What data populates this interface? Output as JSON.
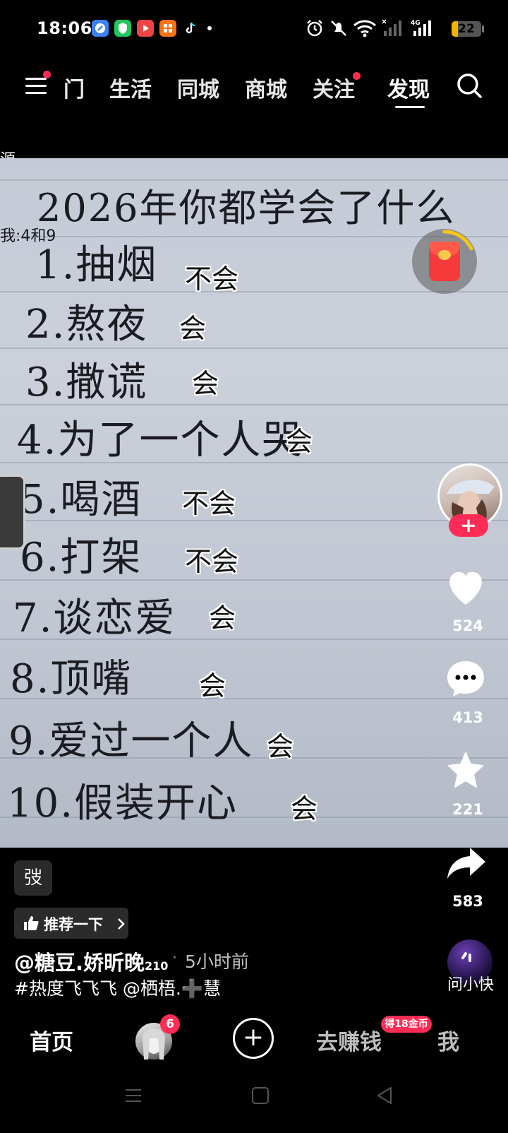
{
  "status_bar": {
    "time": "18:06",
    "battery": "22",
    "battery_level": 0.22,
    "network": "4G",
    "app_icons": [
      "browser-icon",
      "shield-app-icon",
      "video-app-icon",
      "store-app-icon",
      "tiktok-icon"
    ]
  },
  "top_nav": {
    "partial_tab": "门",
    "tabs": [
      "生活",
      "同城",
      "商城",
      "关注",
      "发现"
    ],
    "active_tab": "发现"
  },
  "video": {
    "edge_text_1": "源",
    "edge_text_2": "我:4和9",
    "handwritten_title": "2026年你都学会了什么",
    "items": [
      {
        "text": "1.抽烟",
        "answer": "不会"
      },
      {
        "text": "2.熬夜",
        "answer": "会"
      },
      {
        "text": "3.撒谎",
        "answer": "会"
      },
      {
        "text": "4.为了一个人哭",
        "answer": "会"
      },
      {
        "text": "5.喝酒",
        "answer": "不会"
      },
      {
        "text": "6.打架",
        "answer": "不会"
      },
      {
        "text": "7.谈恋爱",
        "answer": "会"
      },
      {
        "text": "8.顶嘴",
        "answer": "会"
      },
      {
        "text": "9.爱过一个人",
        "answer": "会"
      },
      {
        "text": "10.假装开心",
        "answer": "会"
      }
    ]
  },
  "right_rail": {
    "likes": "524",
    "comments": "413",
    "favorites": "221",
    "shares": "583",
    "ai_label": "问小快"
  },
  "info": {
    "chip": "弢",
    "recommend_label": "推荐一下",
    "author": "@糖豆.娇昕晚",
    "author_suffix": "210",
    "separator": "·",
    "time_ago": "5小时前",
    "caption": "#热度飞飞飞 @栖梧.➕慧"
  },
  "bottom_tabs": {
    "home": "首页",
    "friends_badge": "6",
    "earn": "去赚钱",
    "earn_badge": "得18金币",
    "me": "我"
  },
  "colors": {
    "accent": "#ff2c55",
    "battery": "#f1b400",
    "paper": "#c4cbd6"
  }
}
